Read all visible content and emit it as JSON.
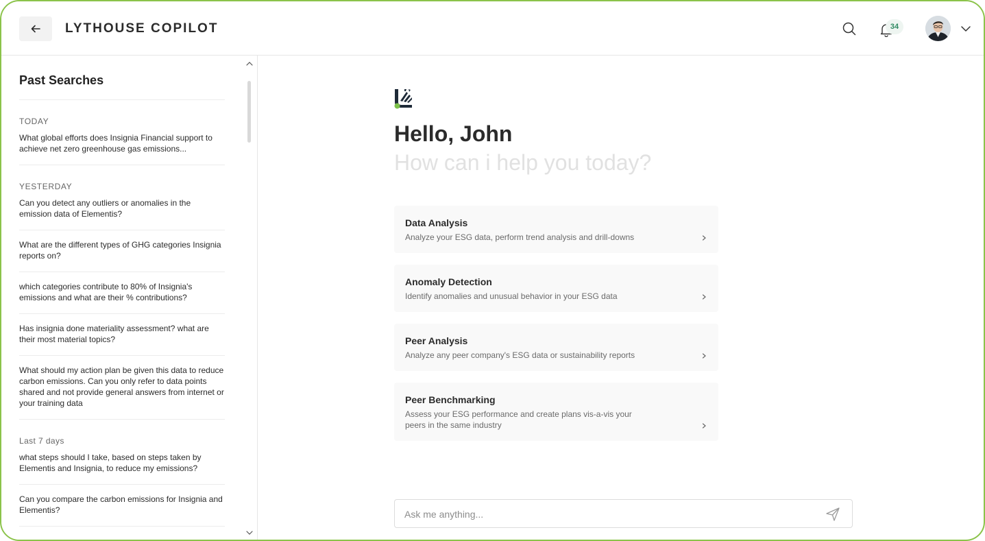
{
  "header": {
    "title": "LYTHOUSE COPILOT",
    "notification_count": "34",
    "icons": {
      "back": "arrow-left-icon",
      "search": "search-icon",
      "notifications": "bell-icon",
      "menu": "chevron-down-icon"
    }
  },
  "sidebar": {
    "title": "Past Searches",
    "groups": [
      {
        "label": "TODAY",
        "items": [
          "What global efforts does Insignia Financial support to achieve net zero greenhouse gas emissions..."
        ]
      },
      {
        "label": "YESTERDAY",
        "items": [
          "Can you detect any outliers or anomalies in the emission data of Elementis?",
          "What are the different types of GHG categories Insignia reports on?",
          "which categories contribute to 80% of Insignia's emissions and what are their % contributions?",
          "Has insignia done materiality assessment? what are their most material topics?",
          "What should my action plan be given this data to reduce carbon emissions. Can you only refer to data points shared and not provide general answers from internet or your training data"
        ]
      },
      {
        "label": "Last 7 days",
        "items": [
          "what steps should I take, based on steps taken by Elementis and Insignia, to reduce my emissions?",
          "Can you compare the carbon emissions for Insignia and Elementis?"
        ]
      }
    ]
  },
  "main": {
    "greeting": "Hello, John",
    "subtitle": "How can i help you today?",
    "cards": [
      {
        "title": "Data Analysis",
        "description": "Analyze your ESG data, perform trend analysis and drill-downs"
      },
      {
        "title": "Anomaly Detection",
        "description": "Identify anomalies and unusual behavior in your ESG data"
      },
      {
        "title": "Peer Analysis",
        "description": "Analyze any peer company's ESG data or sustainability reports"
      },
      {
        "title": "Peer Benchmarking",
        "description": "Assess your ESG performance and create plans vis-a-vis your peers in the same industry"
      }
    ],
    "ask": {
      "placeholder": "Ask me anything...",
      "value": ""
    }
  },
  "colors": {
    "accent_green": "#8bc34a",
    "badge_text": "#2f8a62",
    "card_bg": "#f9f9f9",
    "subtitle_gray": "#e1e1e1"
  }
}
